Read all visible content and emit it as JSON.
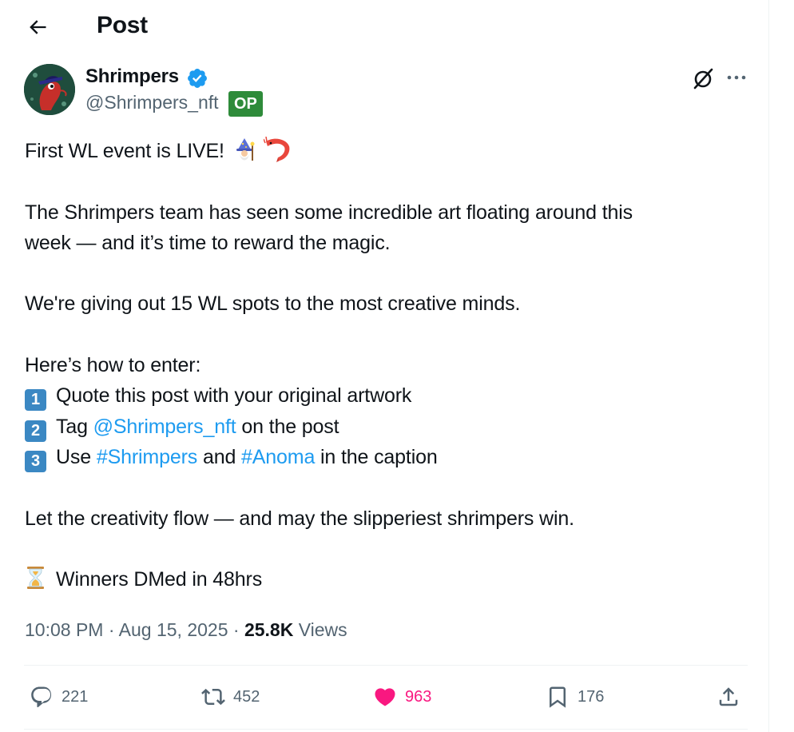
{
  "header": {
    "title": "Post",
    "back_icon": "arrow-left-icon"
  },
  "author": {
    "display_name": "Shrimpers",
    "handle": "@Shrimpers_nft",
    "badge": "OP",
    "verified_color": "#1d9bf0",
    "avatar_icon": "shrimp-avatar-icon"
  },
  "tweet": {
    "line1": "First WL event is LIVE!",
    "line1_emojis": [
      "mage-emoji",
      "shrimp-emoji"
    ],
    "p2_line1": "The Shrimpers team has seen some incredible art floating around this",
    "p2_line2": "week — and it’s time to reward the magic.",
    "p3": "We're giving out 15 WL spots to the most creative minds.",
    "p4_header": "Here’s how to enter:",
    "steps": [
      {
        "num": "1",
        "text": "Quote this post with your original artwork"
      },
      {
        "num": "2",
        "pre": "Tag",
        "mention": "@Shrimpers_nft",
        "post": "on the post"
      },
      {
        "num": "3",
        "pre": "Use",
        "tag1": "#Shrimpers",
        "mid": "and",
        "tag2": "#Anoma",
        "post": "in the caption"
      }
    ],
    "p5": "Let the creativity flow — and may the slipperiest shrimpers win.",
    "p6": "Winners DMed in 48hrs",
    "p6_icon": "hourglass-icon"
  },
  "meta": {
    "time": "10:08 PM",
    "sep": "·",
    "date": "Aug 15, 2025",
    "views_count": "25.8K",
    "views_label": "Views"
  },
  "actions": {
    "replies": "221",
    "reposts": "452",
    "likes": "963",
    "bookmarks": "176",
    "like_color": "#f91880"
  },
  "colors": {
    "text": "#0f1419",
    "secondary": "#536471",
    "link": "#1d9bf0",
    "op_badge": "#2e8b3a",
    "border": "#eff3f4"
  }
}
